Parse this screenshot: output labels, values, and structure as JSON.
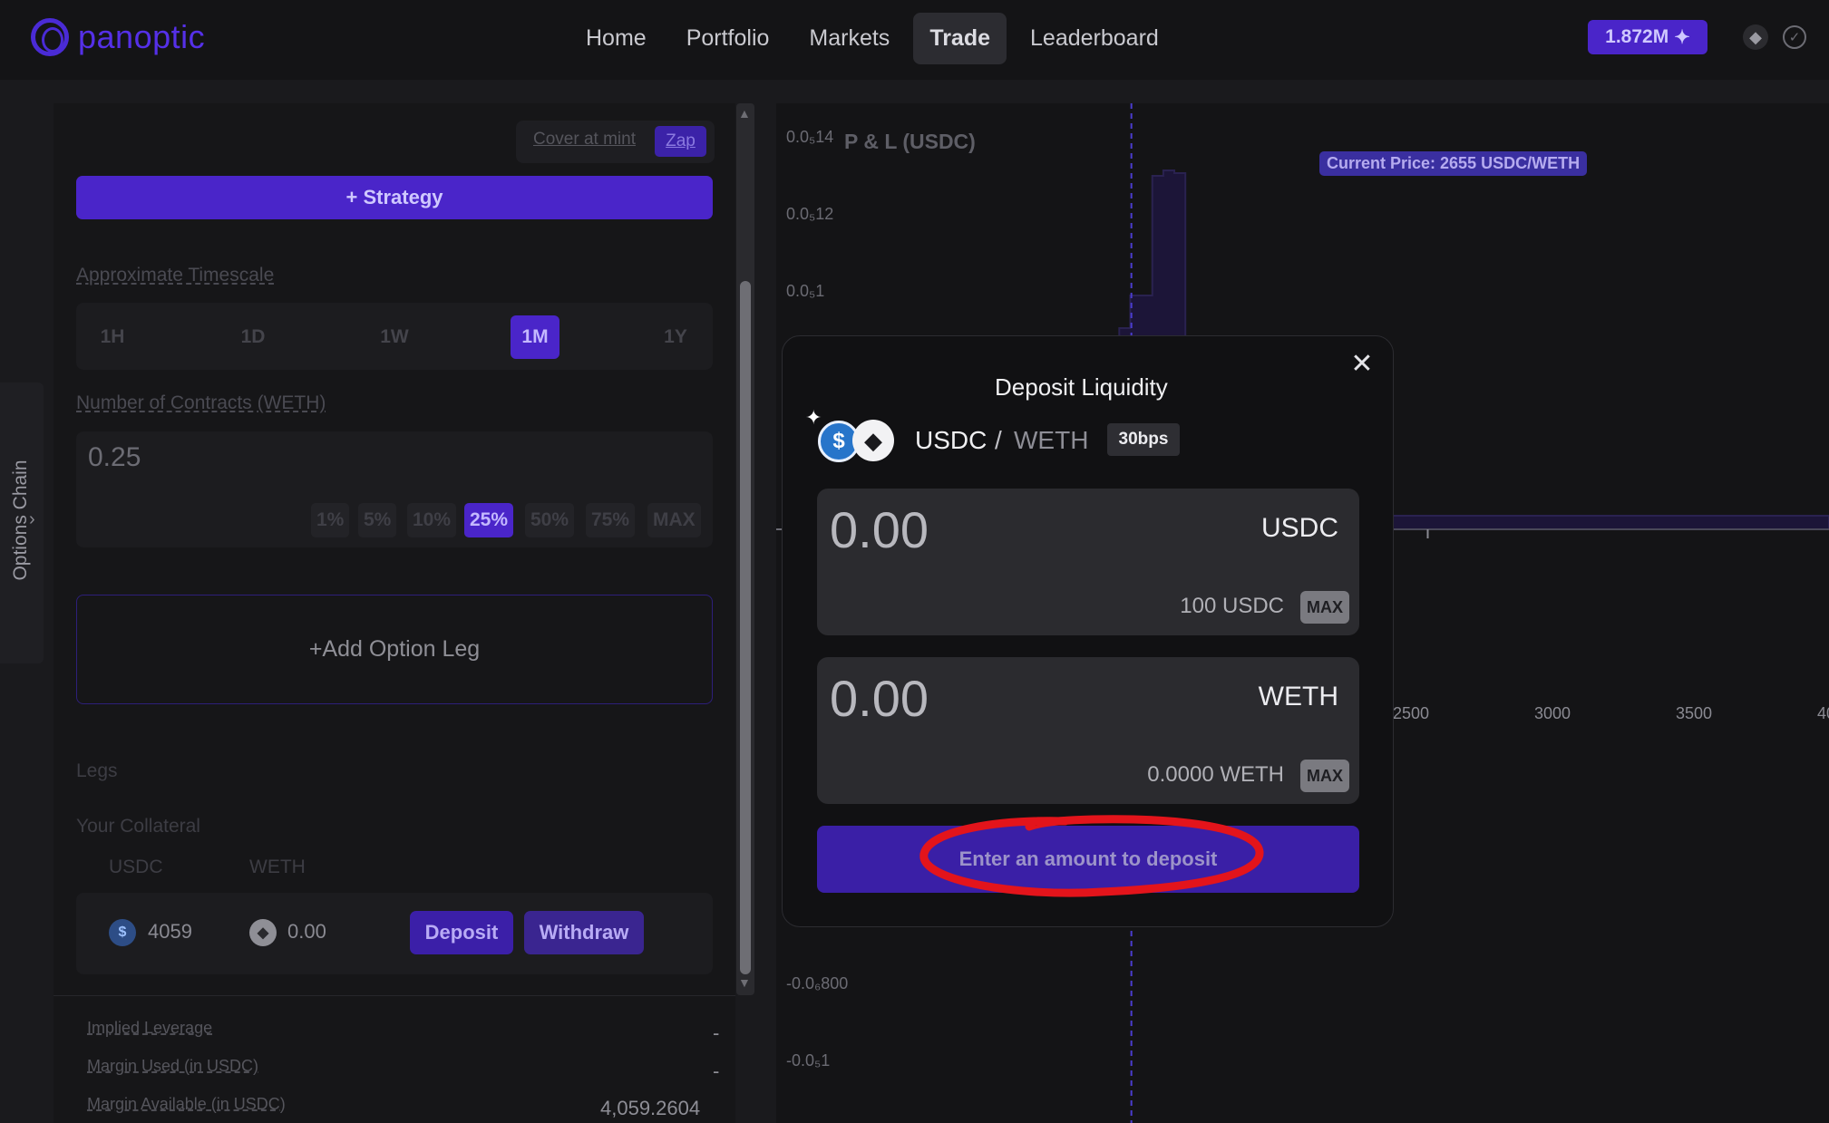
{
  "header": {
    "logo_text": "panoptic",
    "nav": [
      {
        "label": "Home"
      },
      {
        "label": "Portfolio"
      },
      {
        "label": "Markets"
      },
      {
        "label": "Trade"
      },
      {
        "label": "Leaderboard"
      }
    ],
    "active_nav": "Trade",
    "points_badge": "1.872M",
    "points_icon": "sparkle-icon",
    "network_icon": "ethereum-icon",
    "status_icon": "check-circle-icon",
    "brand_color": "#4a25c9"
  },
  "options_chain": {
    "label": "Options Chain",
    "icon": "chevron-right-icon"
  },
  "strategy_panel": {
    "cover_at_mint": "Cover at mint",
    "zap": "Zap",
    "strategy_button": "+ Strategy",
    "timescale_label": "Approximate Timescale",
    "timescales": [
      "1H",
      "1D",
      "1W",
      "1M",
      "1Y"
    ],
    "timescale_selected": "1M",
    "contracts_label": "Number of Contracts (WETH)",
    "contracts_value": "0.25",
    "percentages": [
      "1%",
      "5%",
      "10%",
      "25%",
      "50%",
      "75%",
      "MAX"
    ],
    "percentage_selected": "25%",
    "add_leg": "+Add Option Leg",
    "legs_label": "Legs",
    "collateral_label": "Your Collateral",
    "collateral_cols": [
      "USDC",
      "WETH"
    ],
    "collateral_usdc": "4059",
    "collateral_weth": "0.00",
    "deposit_button": "Deposit",
    "withdraw_button": "Withdraw",
    "stats": [
      {
        "label": "Implied Leverage",
        "value": "-"
      },
      {
        "label": "Margin Used (in USDC)",
        "value": "-"
      },
      {
        "label": "Margin Available (in USDC)",
        "value": "4,059.2604"
      }
    ]
  },
  "chart": {
    "title": "P & L (USDC)",
    "current_price_label": "Current Price: 2655 USDC/WETH",
    "y_ticks_top": [
      "0.0₅14",
      "0.0₅12",
      "0.0₅1"
    ],
    "y_ticks_bottom": [
      "-0.0₆800",
      "-0.0₅1"
    ],
    "x_ticks": [
      "2500",
      "3000",
      "3500",
      "40"
    ]
  },
  "chart_data": {
    "type": "area",
    "title": "P & L (USDC)",
    "xlabel": "",
    "ylabel": "",
    "x": [
      2400,
      2450,
      2500,
      2550,
      2600,
      2650,
      2700,
      2750,
      2800,
      2850,
      2900,
      2950,
      3000,
      3050,
      3100,
      3150,
      3200,
      3250,
      3300,
      3350,
      3400,
      3450,
      3500,
      3550,
      3600,
      3650,
      3700,
      3750,
      3800,
      3850
    ],
    "series": [
      {
        "values": [
          0.1,
          0.2,
          0.32,
          0.48,
          0.74,
          0.86,
          0.86,
          1.3,
          1.32,
          1.31,
          0.52,
          0.52,
          0.32,
          0.2,
          0.18,
          0.14,
          0.14,
          0.12,
          0.11,
          0.1,
          0.09,
          0.08,
          0.07,
          0.06,
          0.06,
          0.06,
          0.05,
          0.05,
          0.05,
          0.05
        ]
      }
    ],
    "current_price": 2655,
    "xlim": [
      2400,
      3850
    ],
    "grid": false
  },
  "modal": {
    "title": "Deposit Liquidity",
    "close_icon": "close-icon",
    "token_a": "USDC",
    "separator": "/",
    "token_b": "WETH",
    "fee_tier": "30bps",
    "inputs": [
      {
        "amount": "0.00",
        "token": "USDC",
        "balance": "100 USDC",
        "max": "MAX"
      },
      {
        "amount": "0.00",
        "token": "WETH",
        "balance": "0.0000 WETH",
        "max": "MAX"
      }
    ],
    "submit_button": "Enter an amount to deposit",
    "annotation_color": "#e3141b"
  }
}
